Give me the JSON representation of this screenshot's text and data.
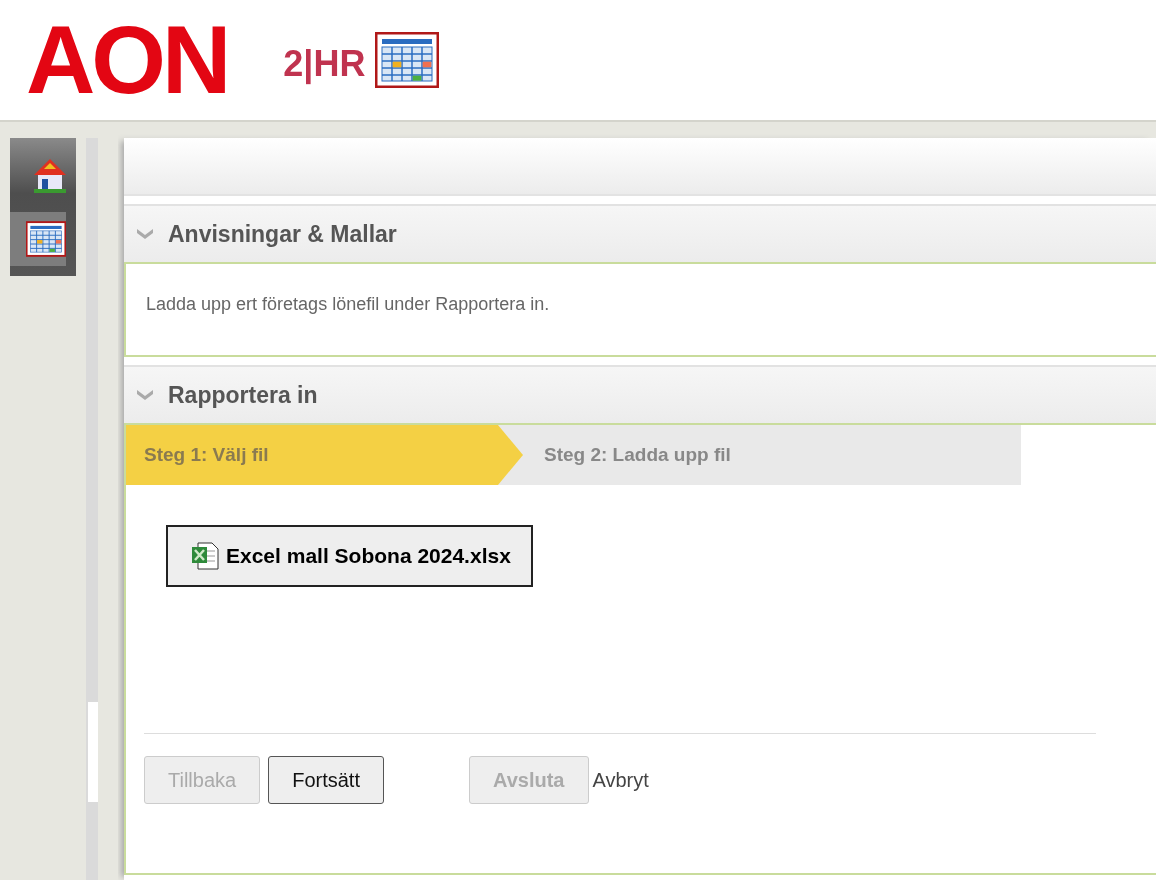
{
  "header": {
    "logo": "AON",
    "product": "2|HR"
  },
  "sidebar": {
    "items": [
      {
        "kind": "house",
        "selected": false
      },
      {
        "kind": "calendar",
        "selected": true
      }
    ]
  },
  "sections": [
    {
      "title": "Anvisningar & Mallar",
      "expanded": true,
      "text": "Ladda upp ert företags lönefil under Rapportera in."
    },
    {
      "title": "Rapportera in",
      "expanded": true,
      "steps": [
        {
          "label": "Steg 1: Välj fil",
          "selected": true
        },
        {
          "label": "Steg 2: Ladda upp fil",
          "selected": false
        }
      ],
      "file_button": {
        "label": "Excel mall Sobona 2024.xlsx"
      },
      "buttons": [
        {
          "label": "Tillbaka",
          "disabled": true
        },
        {
          "label": "Fortsätt",
          "disabled": false
        },
        {
          "label": "Avsluta",
          "disabled": true
        }
      ],
      "cancel_link": "Avbryt"
    }
  ]
}
